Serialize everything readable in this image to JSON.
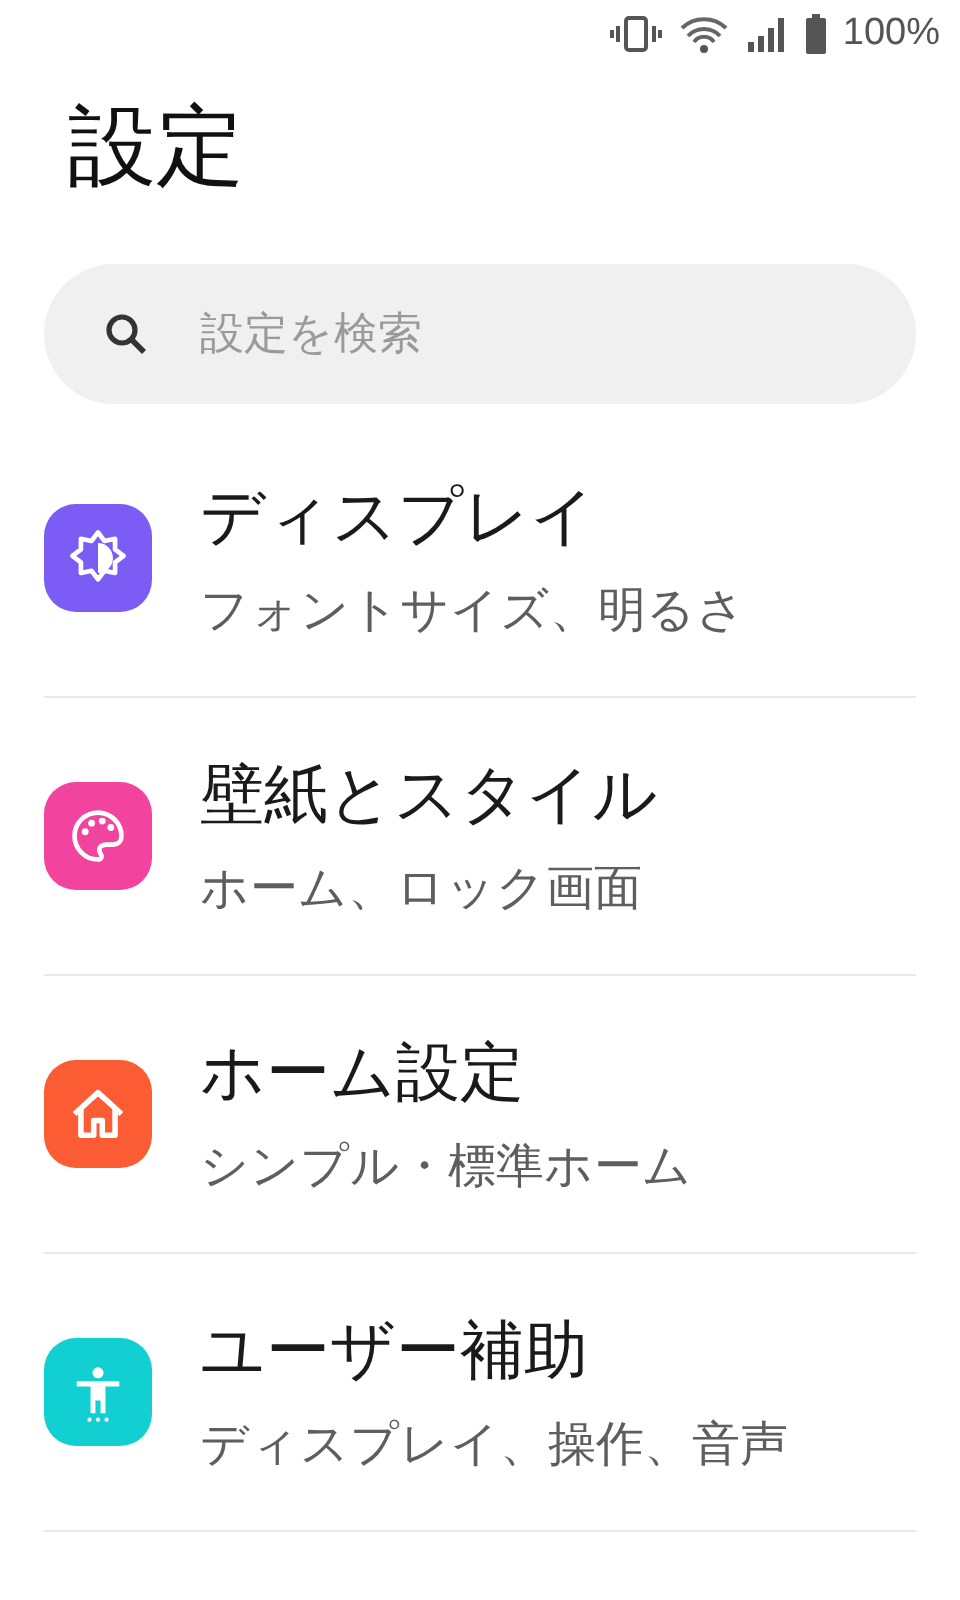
{
  "status_bar": {
    "battery": "100%"
  },
  "title": "設定",
  "search": {
    "placeholder": "設定を検索"
  },
  "items": [
    {
      "kind": "display",
      "color": "#7b5cf5",
      "title": "ディスプレイ",
      "subtitle": "フォントサイズ、明るさ"
    },
    {
      "kind": "wallpaper",
      "color": "#f2439e",
      "title": "壁紙とスタイル",
      "subtitle": "ホーム、ロック画面"
    },
    {
      "kind": "home",
      "color": "#fb5c33",
      "title": "ホーム設定",
      "subtitle": "シンプル・標準ホーム"
    },
    {
      "kind": "accessibility",
      "color": "#12cfd1",
      "title": "ユーザー補助",
      "subtitle": "ディスプレイ、操作、音声"
    }
  ]
}
